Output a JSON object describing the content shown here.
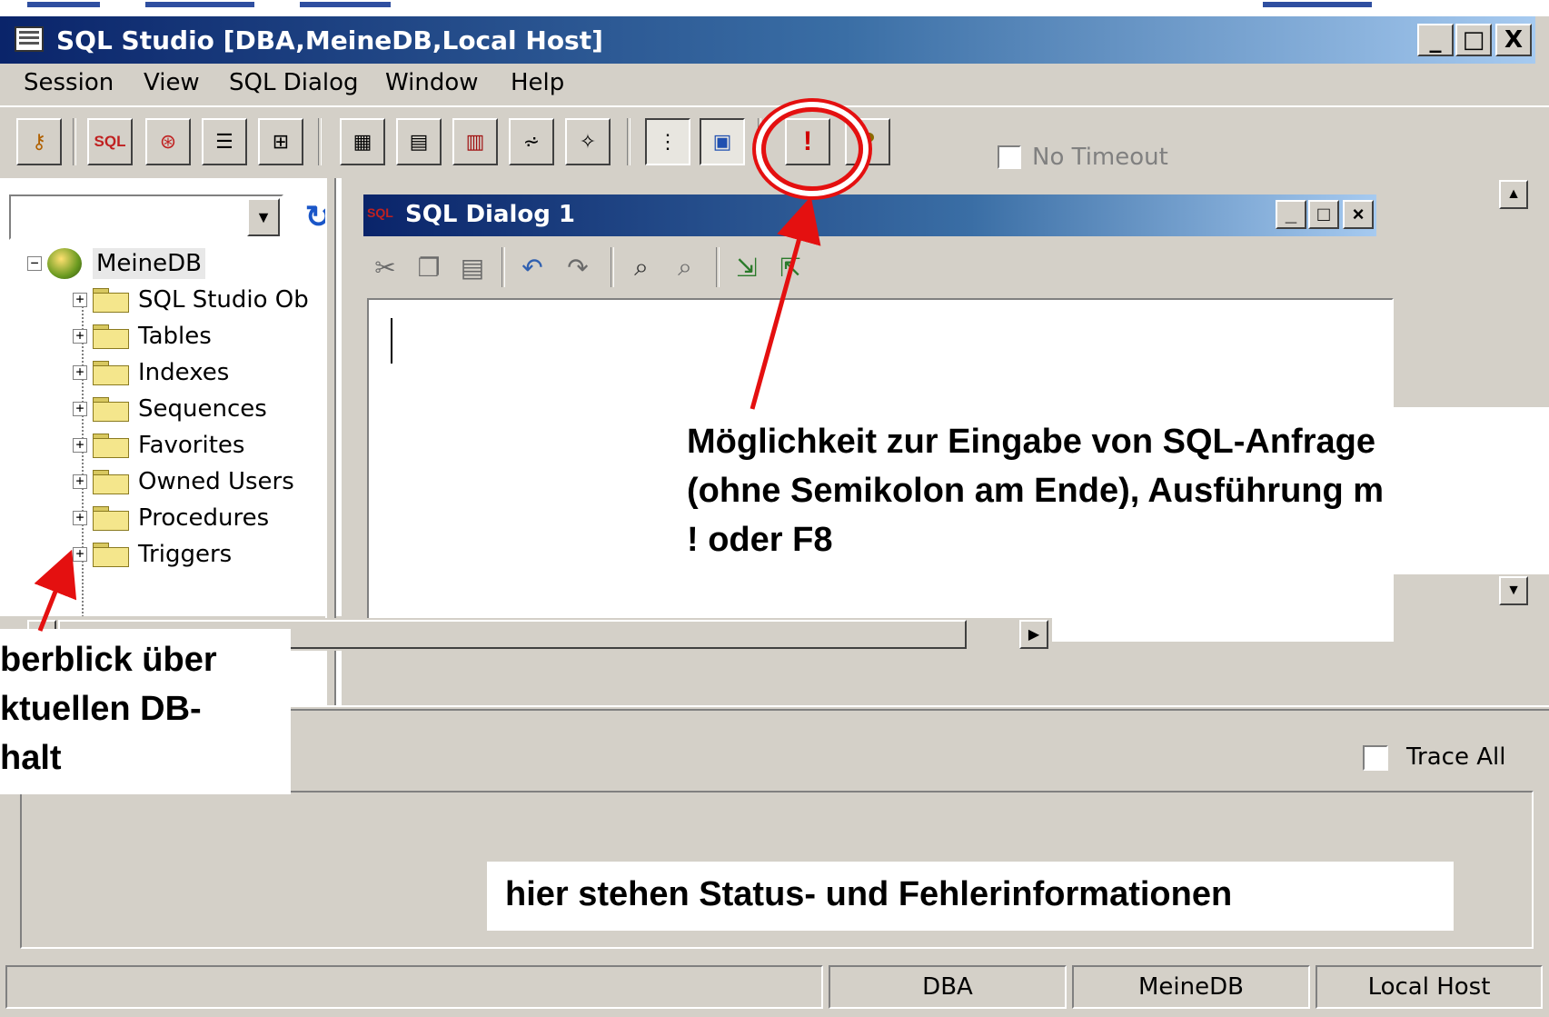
{
  "window": {
    "title": "SQL Studio [DBA,MeineDB,Local Host]",
    "caption_buttons": [
      "_",
      "□",
      "X"
    ]
  },
  "menu": [
    "Session",
    "View",
    "SQL Dialog",
    "Window",
    "Help"
  ],
  "toolbar": {
    "sql_label": "SQL",
    "execute_label": "!",
    "help_label": "?",
    "no_timeout_label": "No Timeout"
  },
  "tree": {
    "root": "MeineDB",
    "items": [
      "SQL Studio Ob",
      "Tables",
      "Indexes",
      "Sequences",
      "Favorites",
      "Owned Users",
      "Procedures",
      "Triggers"
    ]
  },
  "sql_dialog": {
    "title": "SQL Dialog 1",
    "icon_label": "SQL"
  },
  "trace_all_label": "Trace All",
  "statusbar": [
    "DBA",
    "MeineDB",
    "Local Host"
  ],
  "annotations": {
    "editor_note": [
      "Möglichkeit zur Eingabe von SQL-Anfrage",
      "(ohne Semikolon am Ende), Ausführung m",
      "! oder F8"
    ],
    "tree_note": [
      "berblick über",
      "ktuellen DB-",
      "halt"
    ],
    "status_note": "hier stehen Status- und Fehlerinformationen"
  },
  "colors": {
    "title_active": "#0a246a",
    "window_face": "#d4d0c8",
    "annotation_red": "#e41010"
  }
}
